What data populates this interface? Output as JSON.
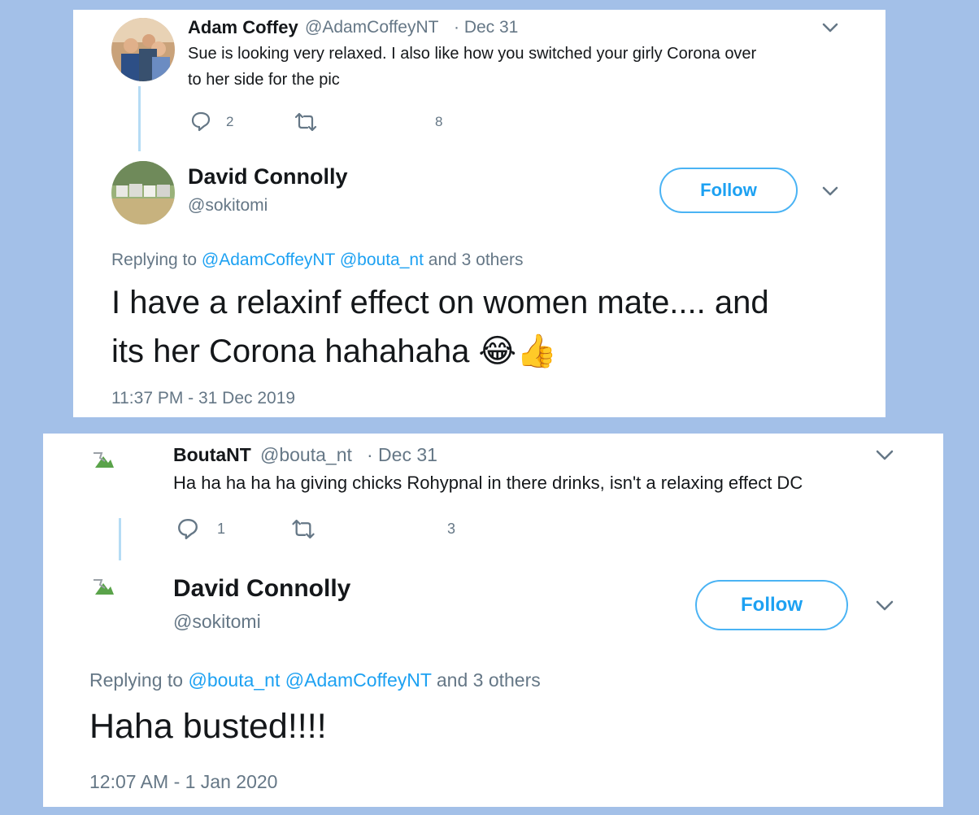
{
  "card1": {
    "parent_tweet": {
      "name": "Adam Coffey",
      "handle": "@AdamCoffeyNT",
      "date": "· Dec 31",
      "text_line1": "Sue is looking very relaxed. I also like how you switched your girly Corona over",
      "text_line2": "to her side for the pic",
      "reply_count": "2",
      "like_count": "8"
    },
    "reply_tweet": {
      "name": "David Connolly",
      "handle": "@sokitomi",
      "follow_label": "Follow",
      "replying_prefix": "Replying to",
      "replying_mention1": "@AdamCoffeyNT",
      "replying_mention2": "@bouta_nt",
      "replying_suffix": "and 3 others",
      "text_line1": "I have a relaxinf effect on women mate.... and",
      "text_line2": "its her Corona hahahaha 😂👍",
      "timestamp": "11:37 PM - 31 Dec 2019"
    }
  },
  "card2": {
    "parent_tweet": {
      "name": "BoutaNT",
      "handle": "@bouta_nt",
      "date": "· Dec 31",
      "text": "Ha ha ha ha ha giving chicks Rohypnal in there drinks, isn't a relaxing effect DC",
      "reply_count": "1",
      "like_count": "3"
    },
    "reply_tweet": {
      "name": "David Connolly",
      "handle": "@sokitomi",
      "follow_label": "Follow",
      "replying_prefix": "Replying to",
      "replying_mention1": "@bouta_nt",
      "replying_mention2": "@AdamCoffeyNT",
      "replying_suffix": "and 3 others",
      "text": "Haha busted!!!!",
      "timestamp": "12:07 AM - 1 Jan 2020"
    }
  },
  "icons": {
    "reply": "reply-icon",
    "retweet": "retweet-icon",
    "chevron": "chevron-down-icon",
    "broken_image": "broken-image-icon"
  },
  "colors": {
    "background": "#a3c0e8",
    "accent": "#1da1f2",
    "muted": "#657786",
    "text": "#14171a"
  }
}
